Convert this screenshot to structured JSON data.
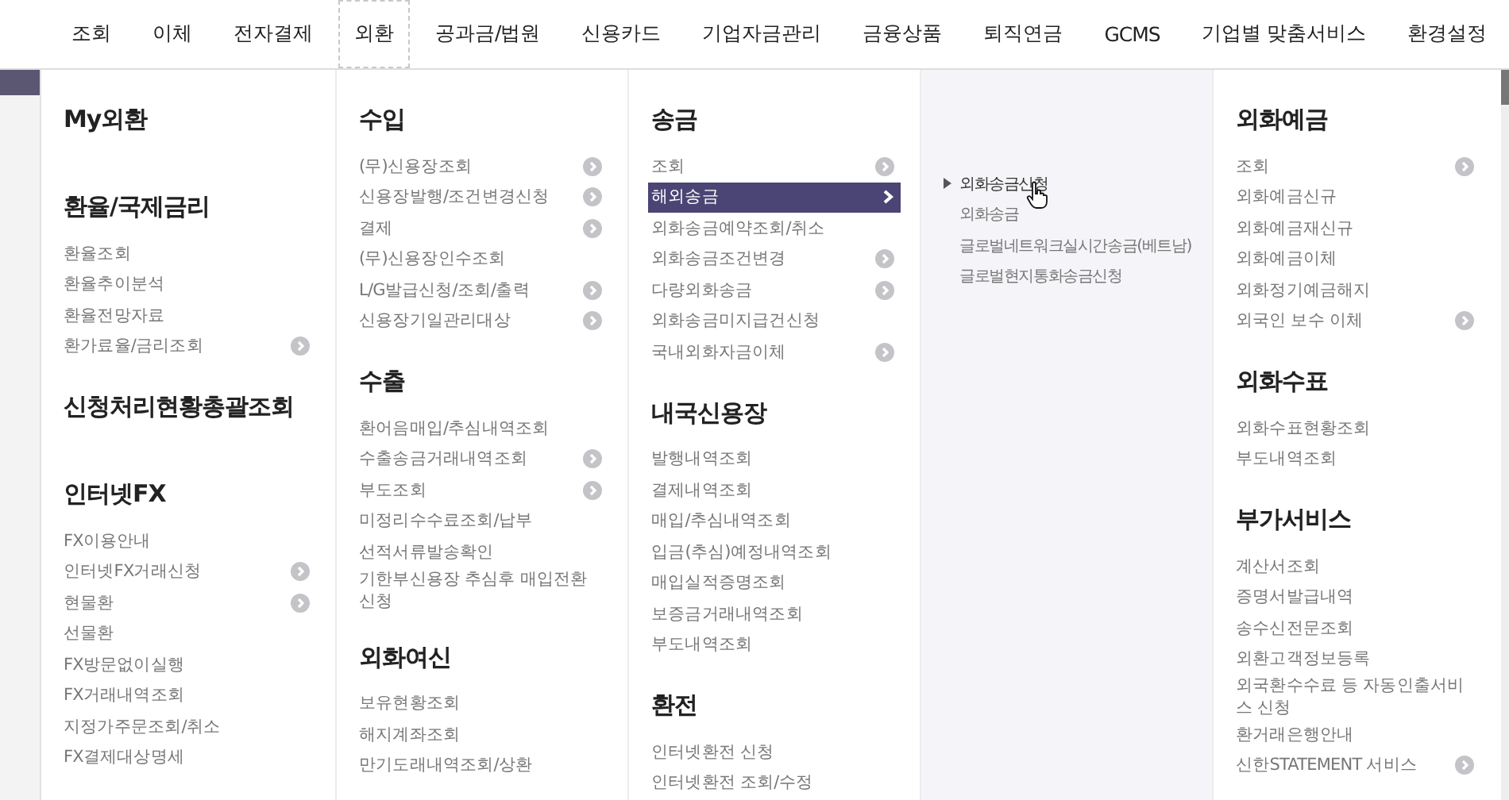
{
  "nav": [
    {
      "label": "조회",
      "selected": false
    },
    {
      "label": "이체",
      "selected": false
    },
    {
      "label": "전자결제",
      "selected": false
    },
    {
      "label": "외환",
      "selected": true
    },
    {
      "label": "공과금/법원",
      "selected": false
    },
    {
      "label": "신용카드",
      "selected": false
    },
    {
      "label": "기업자금관리",
      "selected": false
    },
    {
      "label": "금융상품",
      "selected": false
    },
    {
      "label": "퇴직연금",
      "selected": false
    },
    {
      "label": "GCMS",
      "selected": false
    },
    {
      "label": "기업별 맞춤서비스",
      "selected": false
    },
    {
      "label": "환경설정",
      "selected": false
    }
  ],
  "columns": [
    {
      "kind": "menu",
      "sections": [
        {
          "title": "My외환"
        },
        {
          "title": "환율/국제금리",
          "items": [
            {
              "label": "환율조회",
              "arrow": false,
              "selected": false
            },
            {
              "label": "환율추이분석",
              "arrow": false,
              "selected": false
            },
            {
              "label": "환율전망자료",
              "arrow": false,
              "selected": false
            },
            {
              "label": "환가료율/금리조회",
              "arrow": true,
              "selected": false
            }
          ]
        },
        {
          "title": "신청처리현황총괄조회"
        },
        {
          "title": "인터넷FX",
          "items": [
            {
              "label": "FX이용안내",
              "arrow": false,
              "selected": false
            },
            {
              "label": "인터넷FX거래신청",
              "arrow": true,
              "selected": false
            },
            {
              "label": "현물환",
              "arrow": true,
              "selected": false
            },
            {
              "label": "선물환",
              "arrow": false,
              "selected": false
            },
            {
              "label": "FX방문없이실행",
              "arrow": false,
              "selected": false
            },
            {
              "label": "FX거래내역조회",
              "arrow": false,
              "selected": false
            },
            {
              "label": "지정가주문조회/취소",
              "arrow": false,
              "selected": false
            },
            {
              "label": "FX결제대상명세",
              "arrow": false,
              "selected": false
            }
          ]
        }
      ]
    },
    {
      "kind": "menu",
      "sections": [
        {
          "title": "수입",
          "items": [
            {
              "label": "(무)신용장조회",
              "arrow": true,
              "selected": false
            },
            {
              "label": "신용장발행/조건변경신청",
              "arrow": true,
              "selected": false
            },
            {
              "label": "결제",
              "arrow": true,
              "selected": false
            },
            {
              "label": "(무)신용장인수조회",
              "arrow": false,
              "selected": false
            },
            {
              "label": "L/G발급신청/조회/출력",
              "arrow": true,
              "selected": false
            },
            {
              "label": "신용장기일관리대상",
              "arrow": true,
              "selected": false
            }
          ]
        },
        {
          "title": "수출",
          "items": [
            {
              "label": "환어음매입/추심내역조회",
              "arrow": false,
              "selected": false
            },
            {
              "label": "수출송금거래내역조회",
              "arrow": true,
              "selected": false
            },
            {
              "label": "부도조회",
              "arrow": true,
              "selected": false
            },
            {
              "label": "미정리수수료조회/납부",
              "arrow": false,
              "selected": false
            },
            {
              "label": "선적서류발송확인",
              "arrow": false,
              "selected": false
            },
            {
              "label": "기한부신용장 추심후 매입전환 신청",
              "arrow": false,
              "selected": false
            }
          ]
        },
        {
          "title": "외화여신",
          "items": [
            {
              "label": "보유현황조회",
              "arrow": false,
              "selected": false
            },
            {
              "label": "해지계좌조회",
              "arrow": false,
              "selected": false
            },
            {
              "label": "만기도래내역조회/상환",
              "arrow": false,
              "selected": false
            }
          ]
        }
      ]
    },
    {
      "kind": "menu",
      "sections": [
        {
          "title": "송금",
          "items": [
            {
              "label": "조회",
              "arrow": true,
              "selected": false
            },
            {
              "label": "해외송금",
              "arrow": true,
              "selected": true
            },
            {
              "label": "외화송금예약조회/취소",
              "arrow": false,
              "selected": false
            },
            {
              "label": "외화송금조건변경",
              "arrow": true,
              "selected": false
            },
            {
              "label": "다량외화송금",
              "arrow": true,
              "selected": false
            },
            {
              "label": "외화송금미지급건신청",
              "arrow": false,
              "selected": false
            },
            {
              "label": "국내외화자금이체",
              "arrow": true,
              "selected": false
            }
          ]
        },
        {
          "title": "내국신용장",
          "items": [
            {
              "label": "발행내역조회",
              "arrow": false,
              "selected": false
            },
            {
              "label": "결제내역조회",
              "arrow": false,
              "selected": false
            },
            {
              "label": "매입/추심내역조회",
              "arrow": false,
              "selected": false
            },
            {
              "label": "입금(추심)예정내역조회",
              "arrow": false,
              "selected": false
            },
            {
              "label": "매입실적증명조회",
              "arrow": false,
              "selected": false
            },
            {
              "label": "보증금거래내역조회",
              "arrow": false,
              "selected": false
            },
            {
              "label": "부도내역조회",
              "arrow": false,
              "selected": false
            }
          ]
        },
        {
          "title": "환전",
          "items": [
            {
              "label": "인터넷환전 신청",
              "arrow": false,
              "selected": false
            },
            {
              "label": "인터넷환전 조회/수정",
              "arrow": false,
              "selected": false
            }
          ]
        }
      ]
    },
    {
      "kind": "submenu",
      "items": [
        {
          "label": "외화송금신청",
          "selected": true
        },
        {
          "label": "외화송금",
          "selected": false
        },
        {
          "label": "글로벌네트워크실시간송금(베트남)",
          "selected": false
        },
        {
          "label": "글로벌현지통화송금신청",
          "selected": false
        }
      ]
    },
    {
      "kind": "menu",
      "sections": [
        {
          "title": "외화예금",
          "items": [
            {
              "label": "조회",
              "arrow": true,
              "selected": false
            },
            {
              "label": "외화예금신규",
              "arrow": false,
              "selected": false
            },
            {
              "label": "외화예금재신규",
              "arrow": false,
              "selected": false
            },
            {
              "label": "외화예금이체",
              "arrow": false,
              "selected": false
            },
            {
              "label": "외화정기예금해지",
              "arrow": false,
              "selected": false
            },
            {
              "label": "외국인 보수 이체",
              "arrow": true,
              "selected": false
            }
          ]
        },
        {
          "title": "외화수표",
          "items": [
            {
              "label": "외화수표현황조회",
              "arrow": false,
              "selected": false
            },
            {
              "label": "부도내역조회",
              "arrow": false,
              "selected": false
            }
          ]
        },
        {
          "title": "부가서비스",
          "items": [
            {
              "label": "계산서조회",
              "arrow": false,
              "selected": false
            },
            {
              "label": "증명서발급내역",
              "arrow": false,
              "selected": false
            },
            {
              "label": "송수신전문조회",
              "arrow": false,
              "selected": false
            },
            {
              "label": "외환고객정보등록",
              "arrow": false,
              "selected": false
            },
            {
              "label": "외국환수수료 등 자동인출서비스 신청",
              "arrow": false,
              "selected": false
            },
            {
              "label": "환거래은행안내",
              "arrow": false,
              "selected": false
            },
            {
              "label": "신한STATEMENT 서비스",
              "arrow": true,
              "selected": false
            }
          ]
        }
      ]
    }
  ]
}
